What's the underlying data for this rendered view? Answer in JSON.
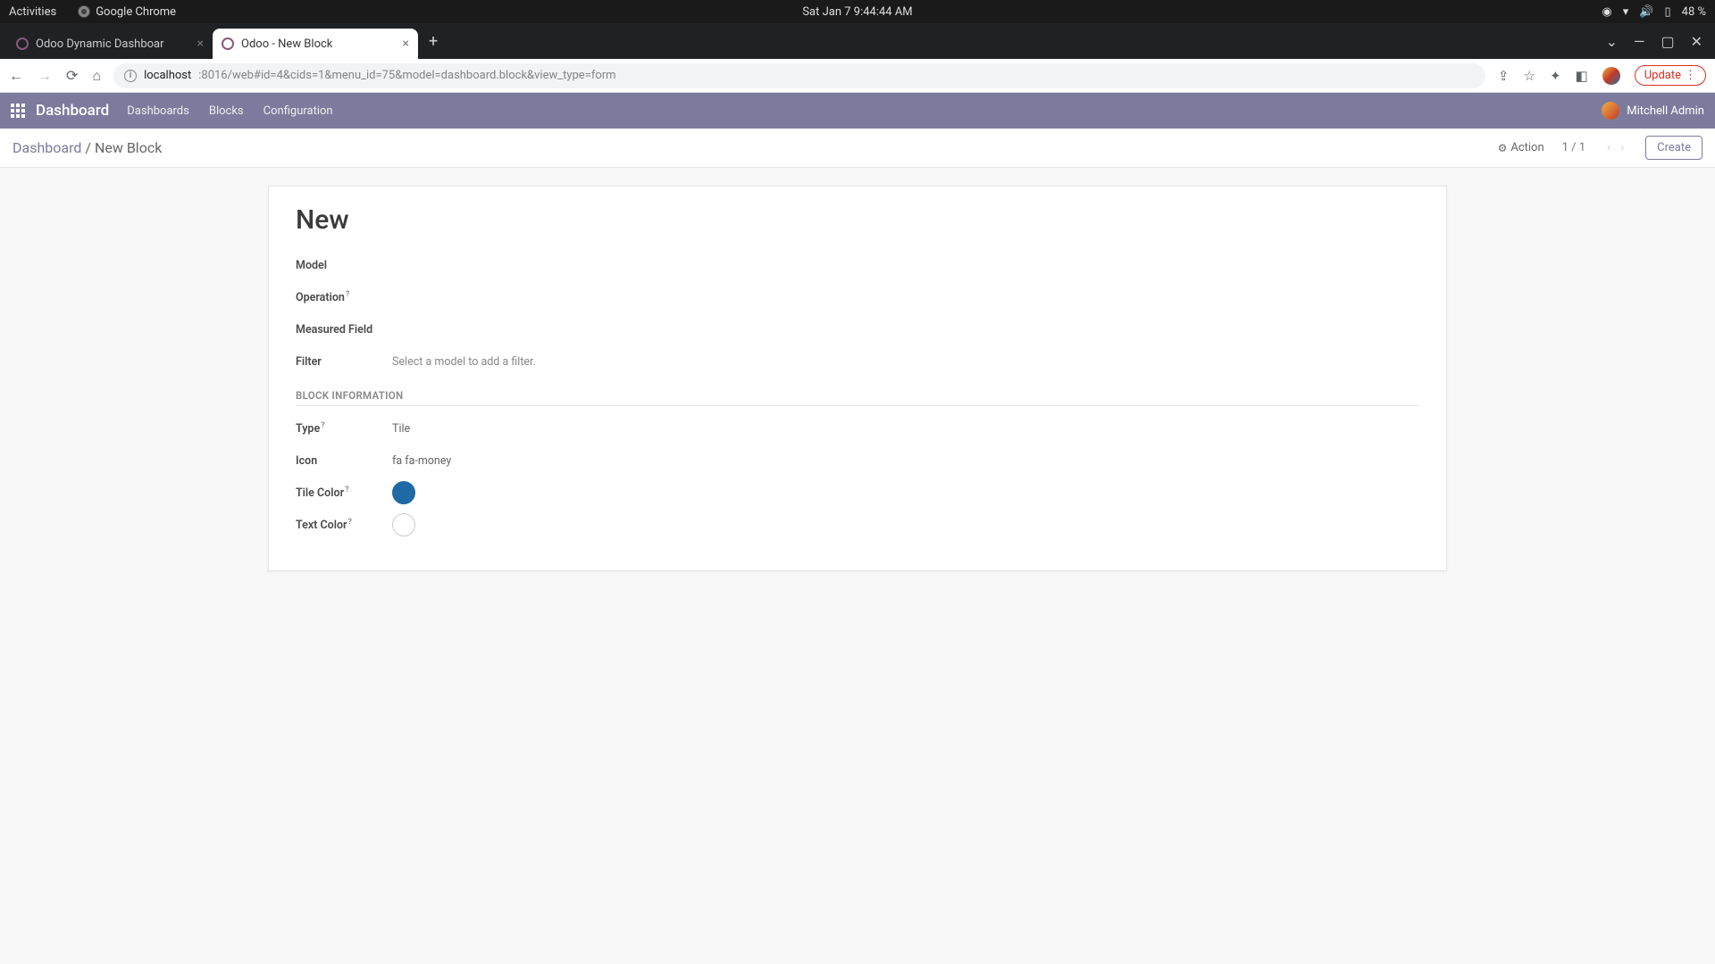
{
  "os": {
    "activities": "Activities",
    "browser": "Google Chrome",
    "clock": "Sat Jan 7  9:44:44 AM",
    "battery": "48 %"
  },
  "tabs": {
    "inactive": "Odoo Dynamic Dashboar",
    "active": "Odoo - New Block"
  },
  "url": {
    "host": "localhost",
    "path": ":8016/web#id=4&cids=1&menu_id=75&model=dashboard.block&view_type=form"
  },
  "chrome": {
    "update": "Update"
  },
  "nav": {
    "brand": "Dashboard",
    "items": [
      "Dashboards",
      "Blocks",
      "Configuration"
    ],
    "user": "Mitchell Admin"
  },
  "breadcrumb": {
    "root": "Dashboard",
    "sep": "/",
    "current": "New Block"
  },
  "controls": {
    "action": "Action",
    "pager": "1 / 1",
    "create": "Create"
  },
  "form": {
    "title": "New",
    "labels": {
      "model": "Model",
      "operation": "Operation",
      "measured": "Measured Field",
      "filter": "Filter",
      "type": "Type",
      "icon": "Icon",
      "tile_color": "Tile Color",
      "text_color": "Text Color"
    },
    "values": {
      "filter": "Select a model to add a filter.",
      "type": "Tile",
      "icon": "fa fa-money",
      "tile_color": "#1f6aa5",
      "text_color": "#ffffff"
    },
    "section": "BLOCK INFORMATION",
    "help": "?"
  }
}
